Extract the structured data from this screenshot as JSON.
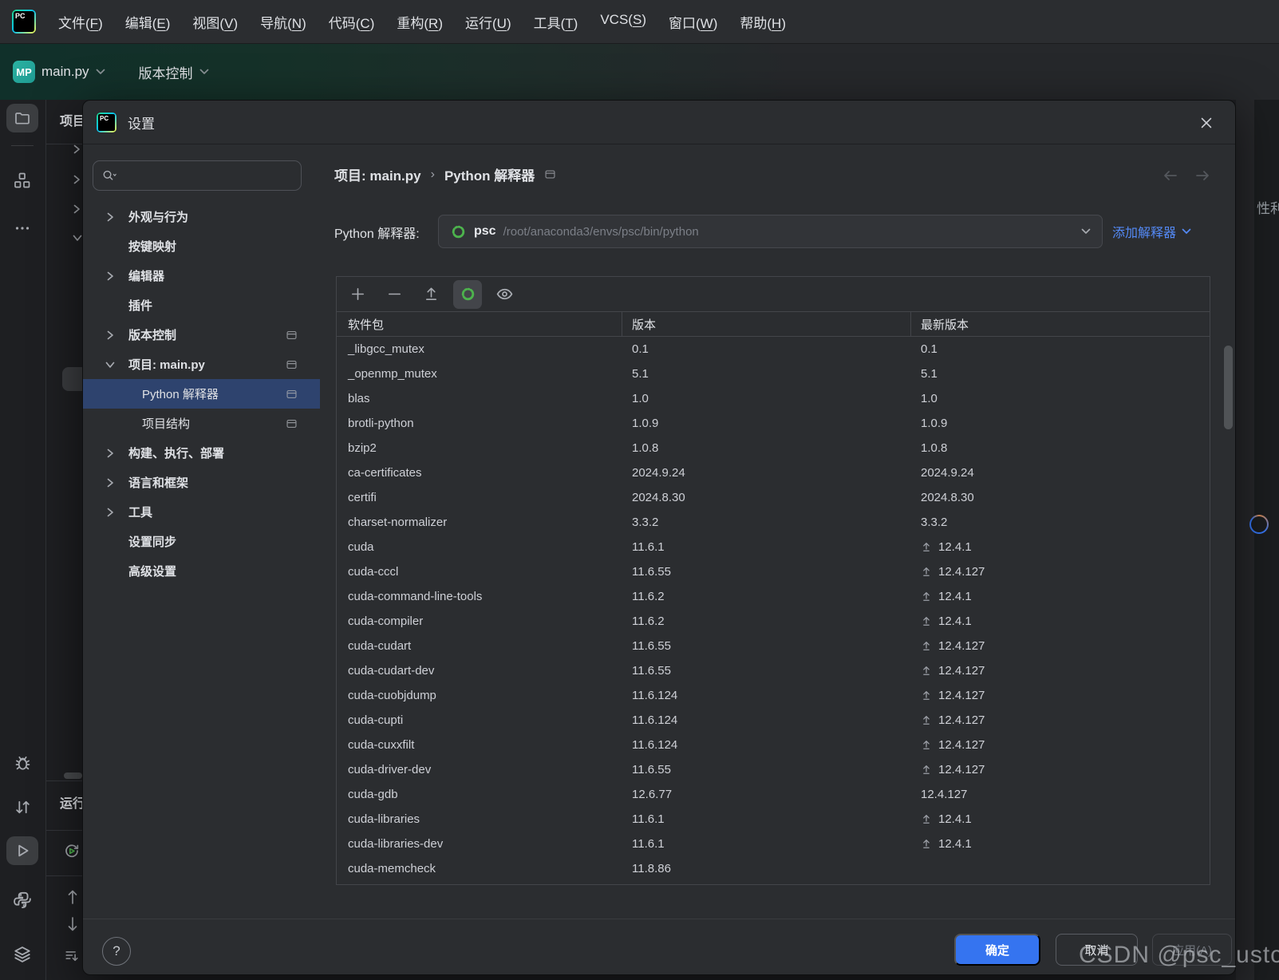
{
  "menubar": {
    "items": [
      {
        "label": "文件",
        "key": "F"
      },
      {
        "label": "编辑",
        "key": "E"
      },
      {
        "label": "视图",
        "key": "V"
      },
      {
        "label": "导航",
        "key": "N"
      },
      {
        "label": "代码",
        "key": "C"
      },
      {
        "label": "重构",
        "key": "R"
      },
      {
        "label": "运行",
        "key": "U"
      },
      {
        "label": "工具",
        "key": "T"
      },
      {
        "label": "VCS",
        "key": "S"
      },
      {
        "label": "窗口",
        "key": "W"
      },
      {
        "label": "帮助",
        "key": "H"
      }
    ]
  },
  "toolbar": {
    "project_badge": "MP",
    "project_name": "main.py",
    "vcs_widget": "版本控制"
  },
  "sidebar": {
    "top_icons": [
      {
        "icon": "folder",
        "active": true
      },
      {
        "icon": "structure",
        "active": false
      },
      {
        "icon": "more",
        "active": false
      }
    ],
    "bottom_icons": [
      {
        "icon": "bug",
        "active": false
      },
      {
        "icon": "updown",
        "active": false
      },
      {
        "icon": "run",
        "active": true
      },
      {
        "icon": "python",
        "active": false
      },
      {
        "icon": "layers",
        "active": false
      }
    ]
  },
  "background": {
    "project_panel_title": "项目",
    "run_panel_title": "运行",
    "right_clipped_text": "性利"
  },
  "dialog": {
    "title": "设置",
    "search_placeholder": "",
    "nav": {
      "items": [
        {
          "label": "外观与行为",
          "level": 0,
          "chevron": "right",
          "monitor": false,
          "selected": false,
          "bold": true
        },
        {
          "label": "按键映射",
          "level": 0,
          "chevron": null,
          "monitor": false,
          "selected": false,
          "bold": true
        },
        {
          "label": "编辑器",
          "level": 0,
          "chevron": "right",
          "monitor": false,
          "selected": false,
          "bold": true
        },
        {
          "label": "插件",
          "level": 0,
          "chevron": null,
          "monitor": false,
          "selected": false,
          "bold": true
        },
        {
          "label": "版本控制",
          "level": 0,
          "chevron": "right",
          "monitor": true,
          "selected": false,
          "bold": true
        },
        {
          "label": "项目: main.py",
          "level": 0,
          "chevron": "down",
          "monitor": true,
          "selected": false,
          "bold": true
        },
        {
          "label": "Python 解释器",
          "level": 1,
          "chevron": null,
          "monitor": true,
          "selected": true,
          "bold": false
        },
        {
          "label": "项目结构",
          "level": 1,
          "chevron": null,
          "monitor": true,
          "selected": false,
          "bold": false
        },
        {
          "label": "构建、执行、部署",
          "level": 0,
          "chevron": "right",
          "monitor": false,
          "selected": false,
          "bold": true
        },
        {
          "label": "语言和框架",
          "level": 0,
          "chevron": "right",
          "monitor": false,
          "selected": false,
          "bold": true
        },
        {
          "label": "工具",
          "level": 0,
          "chevron": "right",
          "monitor": false,
          "selected": false,
          "bold": true
        },
        {
          "label": "设置同步",
          "level": 0,
          "chevron": null,
          "monitor": false,
          "selected": false,
          "bold": true
        },
        {
          "label": "高级设置",
          "level": 0,
          "chevron": null,
          "monitor": false,
          "selected": false,
          "bold": true
        }
      ]
    },
    "breadcrumb": {
      "part1": "项目: main.py",
      "separator": "›",
      "part2": "Python 解释器"
    },
    "interpreter": {
      "label": "Python 解释器:",
      "env_name": "psc",
      "env_path": "/root/anaconda3/envs/psc/bin/python",
      "add_link": "添加解释器"
    },
    "packages": {
      "columns": [
        "软件包",
        "版本",
        "最新版本"
      ],
      "rows": [
        {
          "name": "_libgcc_mutex",
          "version": "0.1",
          "latest": "0.1",
          "upgrade": false
        },
        {
          "name": "_openmp_mutex",
          "version": "5.1",
          "latest": "5.1",
          "upgrade": false
        },
        {
          "name": "blas",
          "version": "1.0",
          "latest": "1.0",
          "upgrade": false
        },
        {
          "name": "brotli-python",
          "version": "1.0.9",
          "latest": "1.0.9",
          "upgrade": false
        },
        {
          "name": "bzip2",
          "version": "1.0.8",
          "latest": "1.0.8",
          "upgrade": false
        },
        {
          "name": "ca-certificates",
          "version": "2024.9.24",
          "latest": "2024.9.24",
          "upgrade": false
        },
        {
          "name": "certifi",
          "version": "2024.8.30",
          "latest": "2024.8.30",
          "upgrade": false
        },
        {
          "name": "charset-normalizer",
          "version": "3.3.2",
          "latest": "3.3.2",
          "upgrade": false
        },
        {
          "name": "cuda",
          "version": "11.6.1",
          "latest": "12.4.1",
          "upgrade": true
        },
        {
          "name": "cuda-cccl",
          "version": "11.6.55",
          "latest": "12.4.127",
          "upgrade": true
        },
        {
          "name": "cuda-command-line-tools",
          "version": "11.6.2",
          "latest": "12.4.1",
          "upgrade": true
        },
        {
          "name": "cuda-compiler",
          "version": "11.6.2",
          "latest": "12.4.1",
          "upgrade": true
        },
        {
          "name": "cuda-cudart",
          "version": "11.6.55",
          "latest": "12.4.127",
          "upgrade": true
        },
        {
          "name": "cuda-cudart-dev",
          "version": "11.6.55",
          "latest": "12.4.127",
          "upgrade": true
        },
        {
          "name": "cuda-cuobjdump",
          "version": "11.6.124",
          "latest": "12.4.127",
          "upgrade": true
        },
        {
          "name": "cuda-cupti",
          "version": "11.6.124",
          "latest": "12.4.127",
          "upgrade": true
        },
        {
          "name": "cuda-cuxxfilt",
          "version": "11.6.124",
          "latest": "12.4.127",
          "upgrade": true
        },
        {
          "name": "cuda-driver-dev",
          "version": "11.6.55",
          "latest": "12.4.127",
          "upgrade": true
        },
        {
          "name": "cuda-gdb",
          "version": "12.6.77",
          "latest": "12.4.127",
          "upgrade": false
        },
        {
          "name": "cuda-libraries",
          "version": "11.6.1",
          "latest": "12.4.1",
          "upgrade": true
        },
        {
          "name": "cuda-libraries-dev",
          "version": "11.6.1",
          "latest": "12.4.1",
          "upgrade": true
        },
        {
          "name": "cuda-memcheck",
          "version": "11.8.86",
          "latest": "",
          "upgrade": false
        }
      ]
    },
    "footer": {
      "ok": "确定",
      "cancel": "取消",
      "apply": "应用(A)"
    }
  },
  "watermark": "CSDN @psc_ustc",
  "colors": {
    "accent": "#3574f0",
    "link": "#548af7",
    "selection": "#2e436e",
    "conda_green": "#4db34d",
    "dialog_bg": "#2b2d30",
    "app_bg": "#1e1f22"
  }
}
